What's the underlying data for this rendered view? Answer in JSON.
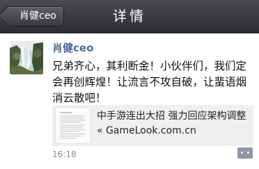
{
  "navbar": {
    "back_label": "肖健ceo",
    "title": "详情"
  },
  "post": {
    "author": "肖健ceo",
    "text": "兄弟齐心，其利断金！小伙伴们，我们定会再创辉煌！让流言不攻自破，让蜚语烟消云散吧！",
    "link": {
      "title": "中手游连出大招 强力回应架构调整 « GameLook.com.cn"
    },
    "time": "16:18"
  },
  "colors": {
    "navbar": "#2c2d30",
    "author_name": "#4f6c96",
    "link_card_bg": "#efefef",
    "comment_button": "#8d96a6"
  },
  "icons": {
    "comment": "comment-bubble-icon"
  }
}
